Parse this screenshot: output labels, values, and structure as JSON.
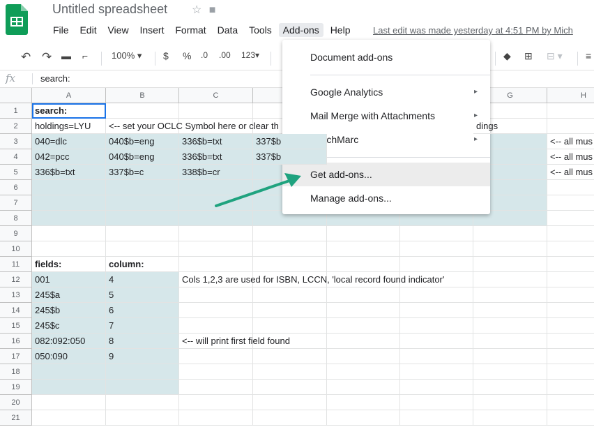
{
  "header": {
    "title": "Untitled spreadsheet",
    "star_icon": "star-icon",
    "folder_icon": "folder-icon",
    "last_edit": "Last edit was made yesterday at 4:51 PM by Mich"
  },
  "menubar": [
    "File",
    "Edit",
    "View",
    "Insert",
    "Format",
    "Data",
    "Tools",
    "Add-ons",
    "Help"
  ],
  "toolbar": {
    "zoom": "100%",
    "currency": "$",
    "percent": "%",
    "decrease_decimal": ".0",
    "increase_decimal": ".00",
    "more_formats": "123"
  },
  "formula_bar": {
    "fx": "fx",
    "value": "search:"
  },
  "columns": [
    "A",
    "B",
    "C",
    "D",
    "E",
    "F",
    "G",
    "H"
  ],
  "rows": [
    "1",
    "2",
    "3",
    "4",
    "5",
    "6",
    "7",
    "8",
    "9",
    "10",
    "11",
    "12",
    "13",
    "14",
    "15",
    "16",
    "17",
    "18",
    "19",
    "20",
    "21"
  ],
  "cells": {
    "A1": "search:",
    "A2": "holdings=LYU",
    "B2": "<-- set your OCLC Symbol here or clear th",
    "G2": "dings",
    "A3": "040=dlc",
    "B3": "040$b=eng",
    "C3": "336$b=txt",
    "D3": "337$b",
    "H3": "<-- all mus",
    "A4": "042=pcc",
    "B4": "040$b=eng",
    "C4": "336$b=txt",
    "D4": "337$b",
    "H4": "<-- all mus",
    "A5": "336$b=txt",
    "B5": "337$b=c",
    "C5": "338$b=cr",
    "H5": "<-- all mus",
    "A11": "fields:",
    "B11": "column:",
    "A12": "001",
    "B12": "4",
    "C12": "Cols 1,2,3 are used for ISBN, LCCN, 'local record found indicator'",
    "A13": "245$a",
    "B13": "5",
    "A14": "245$b",
    "B14": "6",
    "A15": "245$c",
    "B15": "7",
    "A16": "082:092:050",
    "B16": "8",
    "C16": "<-- will print first field found",
    "A17": "050:090",
    "B17": "9"
  },
  "addons_menu": {
    "items": [
      {
        "label": "Document add-ons"
      },
      {
        "label": "Google Analytics",
        "submenu": "▸"
      },
      {
        "label": "Mail Merge with Attachments",
        "submenu": "▸"
      },
      {
        "label": "MatchMarc",
        "submenu": "▸"
      },
      {
        "label": "Get add-ons..."
      },
      {
        "label": "Manage add-ons..."
      }
    ]
  },
  "colors": {
    "accent": "#1a73e8",
    "sheets_green": "#0f9d58",
    "shade": "#d6e7ea",
    "arrow": "#1fa37f"
  }
}
